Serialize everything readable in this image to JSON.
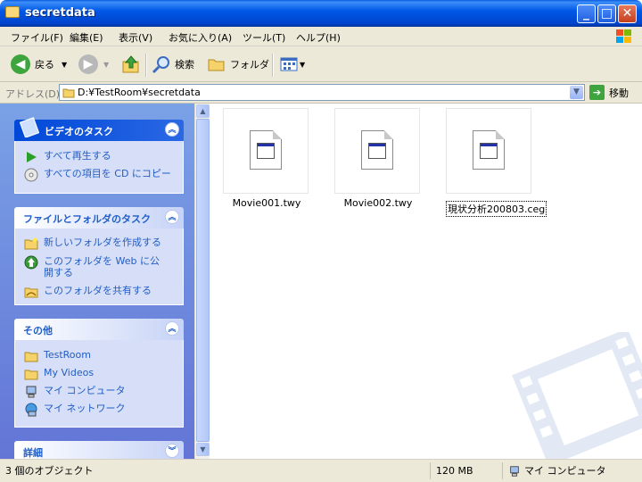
{
  "window": {
    "title": "secretdata"
  },
  "menu": [
    "ファイル(F)",
    "編集(E)",
    "表示(V)",
    "お気に入り(A)",
    "ツール(T)",
    "ヘルプ(H)"
  ],
  "toolbar": {
    "back": "戻る",
    "search": "検索",
    "folders": "フォルダ"
  },
  "address": {
    "label": "アドレス(D)",
    "value": "D:¥TestRoom¥secretdata",
    "go": "移動"
  },
  "left_pane": {
    "video_tasks": {
      "title": "ビデオのタスク",
      "items": [
        "すべて再生する",
        "すべての項目を CD にコピー"
      ]
    },
    "file_tasks": {
      "title": "ファイルとフォルダのタスク",
      "items": [
        "新しいフォルダを作成する",
        "このフォルダを Web に公開する",
        "このフォルダを共有する"
      ]
    },
    "other_places": {
      "title": "その他",
      "items": [
        "TestRoom",
        "My Videos",
        "マイ コンピュータ",
        "マイ ネットワーク"
      ]
    },
    "details": {
      "title": "詳細"
    }
  },
  "files": [
    {
      "name": "Movie001.twy",
      "selected": false
    },
    {
      "name": "Movie002.twy",
      "selected": false
    },
    {
      "name": "現状分析200803.ceg",
      "selected": true
    }
  ],
  "status": {
    "objects": "3 個のオブジェクト",
    "size": "120 MB",
    "location": "マイ コンピュータ"
  },
  "colors": {
    "title_bar": "#0058e6",
    "task_link": "#215dc6",
    "pane_bg": "#7aa1e6"
  }
}
